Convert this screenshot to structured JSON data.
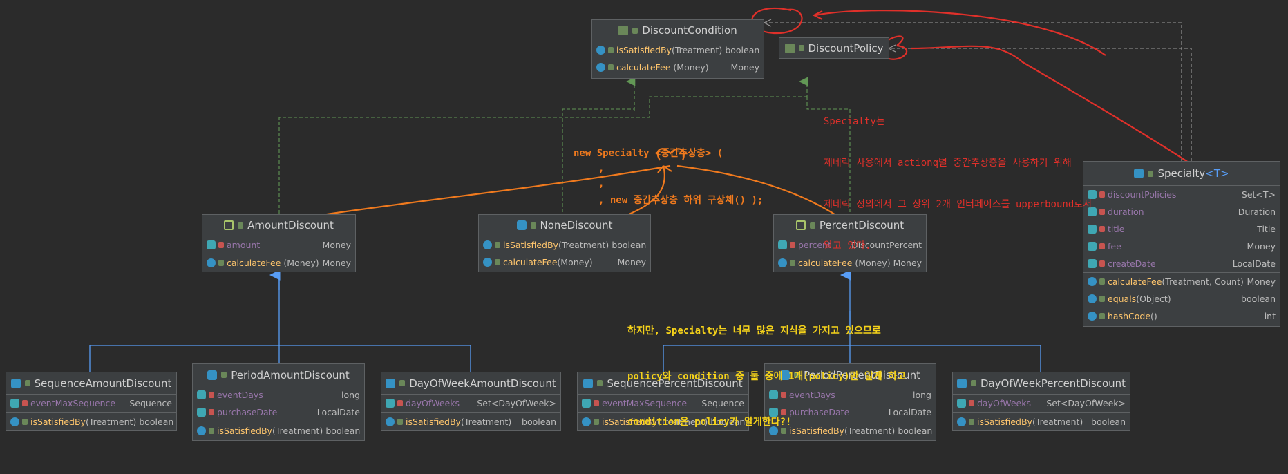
{
  "boxes": {
    "discount_condition": {
      "title": "DiscountCondition",
      "m1": {
        "name": "isSatisfiedBy",
        "params": "(Treatment)",
        "type": "boolean"
      },
      "m2": {
        "name": "calculateFee",
        "params": "(Money)",
        "type": "Money"
      }
    },
    "discount_policy": {
      "title": "DiscountPolicy"
    },
    "amount_discount": {
      "title": "AmountDiscount",
      "f1": {
        "name": "amount",
        "type": "Money"
      },
      "m1": {
        "name": "calculateFee",
        "params": "(Money)",
        "type": "Money"
      }
    },
    "none_discount": {
      "title": "NoneDiscount",
      "m1": {
        "name": "isSatisfiedBy",
        "params": "(Treatment)",
        "type": "boolean"
      },
      "m2": {
        "name": "calculateFee",
        "params": "(Money)",
        "type": "Money"
      }
    },
    "percent_discount": {
      "title": "PercentDiscount",
      "f1": {
        "name": "percent",
        "type": "DiscountPercent"
      },
      "m1": {
        "name": "calculateFee",
        "params": "(Money)",
        "type": "Money"
      }
    },
    "specialty": {
      "title_prefix": "Specialty",
      "title_generic": "<T>",
      "fields": [
        {
          "name": "discountPolicies",
          "type": "Set<T>"
        },
        {
          "name": "duration",
          "type": "Duration"
        },
        {
          "name": "title",
          "type": "Title"
        },
        {
          "name": "fee",
          "type": "Money"
        },
        {
          "name": "createDate",
          "type": "LocalDate"
        }
      ],
      "methods": [
        {
          "name": "calculateFee",
          "params": "(Treatment, Count)",
          "type": "Money"
        },
        {
          "name": "equals",
          "params": "(Object)",
          "type": "boolean"
        },
        {
          "name": "hashCode",
          "params": "()",
          "type": "int"
        }
      ]
    },
    "sequence_amount": {
      "title": "SequenceAmountDiscount",
      "f1": {
        "name": "eventMaxSequence",
        "type": "Sequence"
      },
      "m1": {
        "name": "isSatisfiedBy",
        "params": "(Treatment)",
        "type": "boolean"
      }
    },
    "period_amount": {
      "title": "PeriodAmountDiscount",
      "f1": {
        "name": "eventDays",
        "type": "long"
      },
      "f2": {
        "name": "purchaseDate",
        "type": "LocalDate"
      },
      "m1": {
        "name": "isSatisfiedBy",
        "params": "(Treatment)",
        "type": "boolean"
      }
    },
    "dayofweek_amount": {
      "title": "DayOfWeekAmountDiscount",
      "f1": {
        "name": "dayOfWeeks",
        "type": "Set<DayOfWeek>"
      },
      "m1": {
        "name": "isSatisfiedBy",
        "params": "(Treatment)",
        "type": "boolean"
      }
    },
    "sequence_percent": {
      "title": "SequencePercentDiscount",
      "f1": {
        "name": "eventMaxSequence",
        "type": "Sequence"
      },
      "m1": {
        "name": "isSatisfiedBy",
        "params": "(Treatment)",
        "type": "boolean"
      }
    },
    "period_percent": {
      "title": "PeriodPercentDiscount",
      "f1": {
        "name": "eventDays",
        "type": "long"
      },
      "f2": {
        "name": "purchaseDate",
        "type": "LocalDate"
      },
      "m1": {
        "name": "isSatisfiedBy",
        "params": "(Treatment)",
        "type": "boolean"
      }
    },
    "dayofweek_percent": {
      "title": "DayOfWeekPercentDiscount",
      "f1": {
        "name": "dayOfWeeks",
        "type": "Set<DayOfWeek>"
      },
      "m1": {
        "name": "isSatisfiedBy",
        "params": "(Treatment)",
        "type": "boolean"
      }
    }
  },
  "notes": {
    "red_1": "Specialty는",
    "red_2": "제네릭 사용에서 actionq별 중간추상층을 사용하기 위해",
    "red_3": "제네릭 정의에서 그 상위 2개 인터페이스를 upperbound로서",
    "red_4": "알고 있다.",
    "orange_1": "new Specialty <중간추상층> (",
    "orange_2": ",",
    "orange_3": ",",
    "orange_4": ", new 중간추상층 하위 구상체() );",
    "yellow_1": "하지만, Specialty는 너무 많은 지식을 가지고 있으므로",
    "yellow_2": "policy와 condition 중 둘 중에 1개(policy)만 알게 하고",
    "yellow_3": "condition은 policy가 알게한다?!"
  },
  "colors": {
    "background": "#2b2b2b",
    "box": "#3c3f41",
    "border": "#5e6163",
    "inherit_arrow": "#589df6",
    "implement_arrow": "#629755",
    "dependency_line": "#9a9a9a",
    "red_annotation": "#e0302a",
    "orange_annotation": "#f07a1e",
    "yellow_annotation": "#f5d21a"
  }
}
